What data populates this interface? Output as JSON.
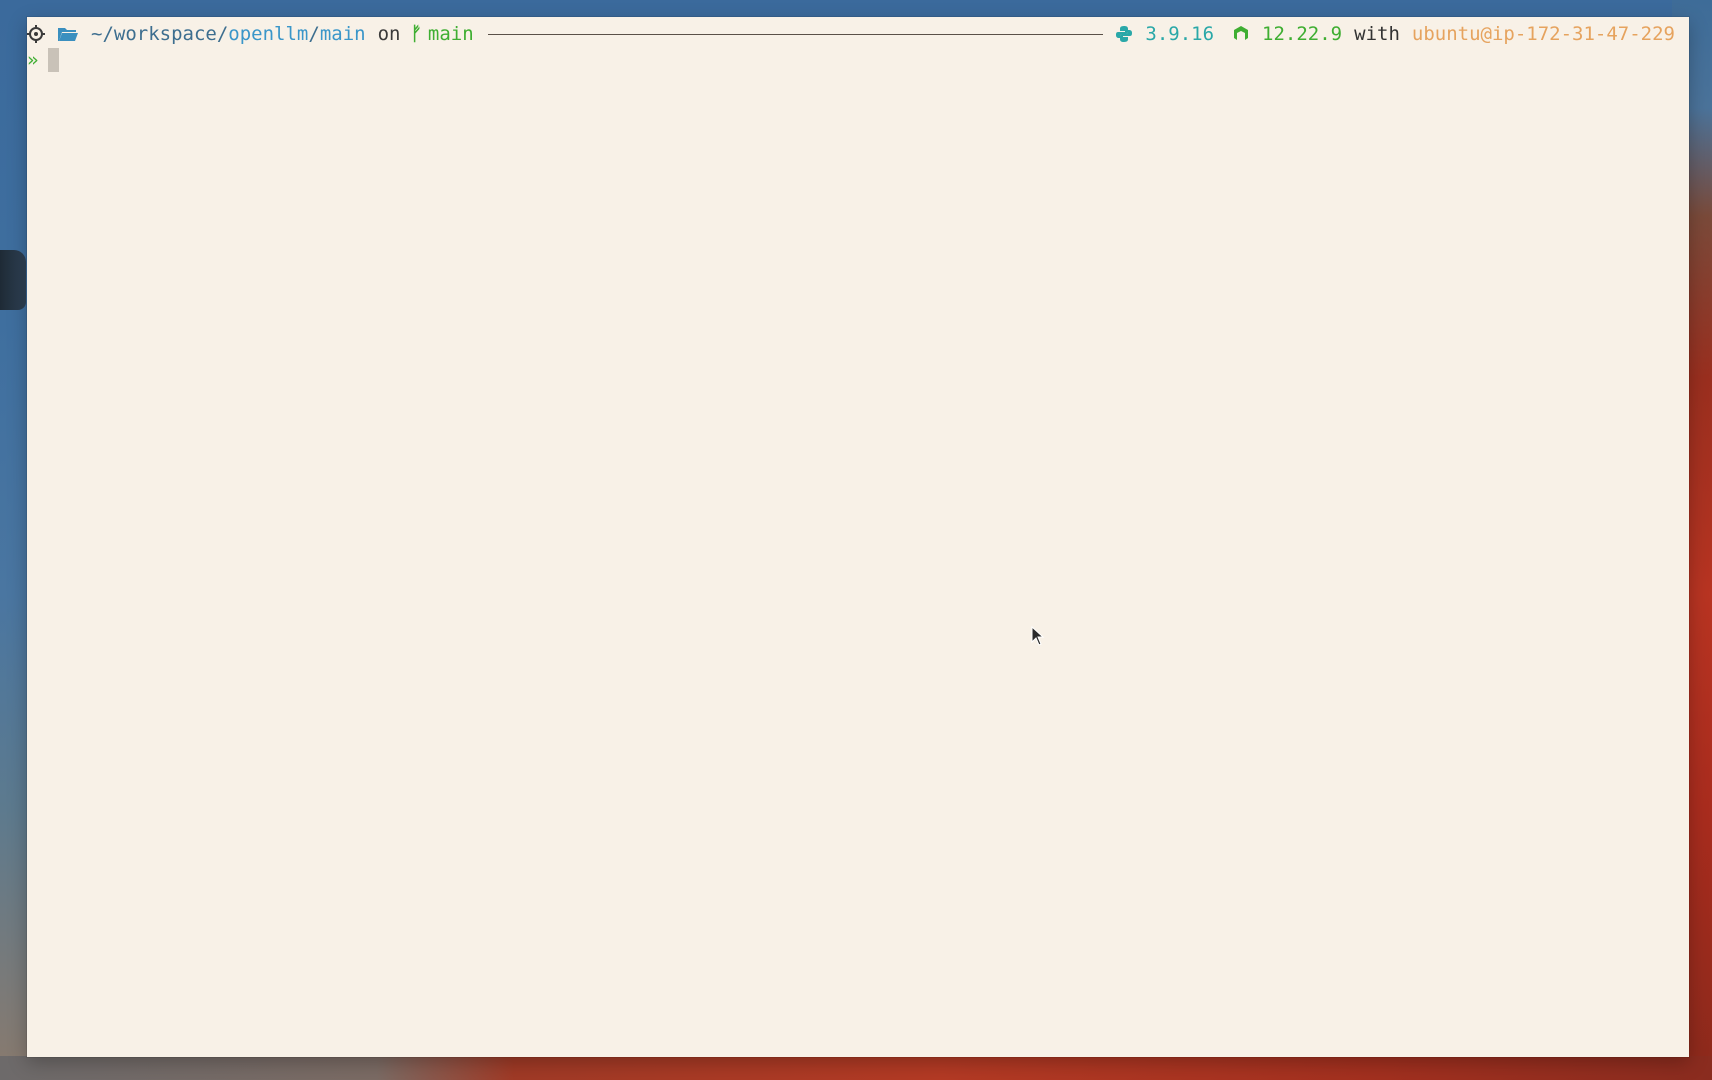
{
  "window": {
    "type": "terminal"
  },
  "prompt": {
    "os_icon": "gear-icon",
    "folder_icon": "folder-icon",
    "path_prefix": "~/workspace/",
    "path_highlight": "openllm",
    "path_sep": "/",
    "path_tail": "main",
    "on_label": "on",
    "branch_icon": "git-branch-icon",
    "branch_glyph": "ᚠ",
    "branch": "main",
    "python_icon": "python-icon",
    "python_version": "3.9.16",
    "node_icon": "node-icon",
    "node_version": "12.22.9",
    "with_label": "with",
    "host": "ubuntu@ip-172-31-47-229"
  },
  "input": {
    "prompt_symbol": "»",
    "value": ""
  },
  "colors": {
    "background": "#f8f1e7",
    "path": "#3a96c9",
    "branch": "#3fae32",
    "python": "#2aa8a8",
    "host": "#e6a35e"
  }
}
